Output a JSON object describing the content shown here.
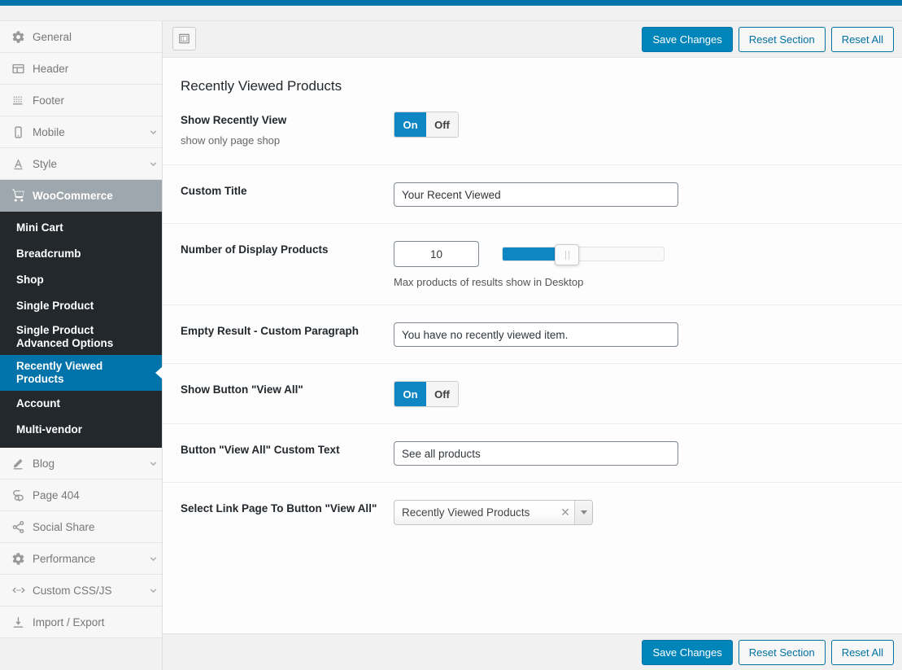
{
  "theme": {
    "adminbar_color": "#0073aa",
    "accent": "#0073aa",
    "submenu_bg": "#23282d",
    "toggle_on_color": "#0e86c4",
    "slider_fill_color": "#0e86c4"
  },
  "toolbar": {
    "expand_icon": "layout-panel-icon",
    "save_label": "Save Changes",
    "reset_section_label": "Reset Section",
    "reset_all_label": "Reset All"
  },
  "sidebar": {
    "items": [
      {
        "label": "General",
        "icon": "gear-icon",
        "caret": false,
        "state": "normal"
      },
      {
        "label": "Header",
        "icon": "header-icon",
        "caret": false,
        "state": "normal"
      },
      {
        "label": "Footer",
        "icon": "footer-icon",
        "caret": false,
        "state": "normal"
      },
      {
        "label": "Mobile",
        "icon": "mobile-icon",
        "caret": true,
        "state": "normal"
      },
      {
        "label": "Style",
        "icon": "typography-icon",
        "caret": true,
        "state": "normal"
      },
      {
        "label": "WooCommerce",
        "icon": "cart-icon",
        "caret": false,
        "state": "active-parent"
      },
      {
        "label": "Blog",
        "icon": "pencil-icon",
        "caret": true,
        "state": "normal"
      },
      {
        "label": "Page 404",
        "icon": "page-search-icon",
        "caret": false,
        "state": "normal"
      },
      {
        "label": "Social Share",
        "icon": "share-icon",
        "caret": false,
        "state": "normal"
      },
      {
        "label": "Performance",
        "icon": "gear-icon",
        "caret": true,
        "state": "normal"
      },
      {
        "label": "Custom CSS/JS",
        "icon": "code-icon",
        "caret": true,
        "state": "normal"
      },
      {
        "label": "Import / Export",
        "icon": "download-icon",
        "caret": false,
        "state": "normal"
      }
    ],
    "submenu": [
      {
        "label": "Mini Cart",
        "active": false
      },
      {
        "label": "Breadcrumb",
        "active": false
      },
      {
        "label": "Shop",
        "active": false
      },
      {
        "label": "Single Product",
        "active": false
      },
      {
        "label": "Single Product Advanced Options",
        "active": false
      },
      {
        "label": "Recently Viewed Products",
        "active": true
      },
      {
        "label": "Account",
        "active": false
      },
      {
        "label": "Multi-vendor",
        "active": false
      }
    ]
  },
  "main": {
    "section_title": "Recently Viewed Products",
    "fields": {
      "show_recently_view": {
        "label": "Show Recently View",
        "sublabel": "show only page shop",
        "on_label": "On",
        "off_label": "Off",
        "value": "On"
      },
      "custom_title": {
        "label": "Custom Title",
        "value": "Your Recent Viewed",
        "placeholder": ""
      },
      "number_of_products": {
        "label": "Number of Display Products",
        "value": "10",
        "description": "Max products of results show in Desktop",
        "slider_min": 1,
        "slider_max": 25,
        "slider_percent": 40
      },
      "empty_result": {
        "label": "Empty Result - Custom Paragraph",
        "value": "You have no recently viewed item.",
        "placeholder": ""
      },
      "show_view_all_button": {
        "label": "Show Button \"View All\"",
        "on_label": "On",
        "off_label": "Off",
        "value": "On"
      },
      "view_all_custom_text": {
        "label": "Button \"View All\" Custom Text",
        "value": "See all products",
        "placeholder": ""
      },
      "view_all_link_page": {
        "label": "Select Link Page To Button \"View All\"",
        "value": "Recently Viewed Products",
        "clear_icon": "x-clear-icon",
        "arrow_icon": "chevron-down-icon"
      }
    }
  }
}
